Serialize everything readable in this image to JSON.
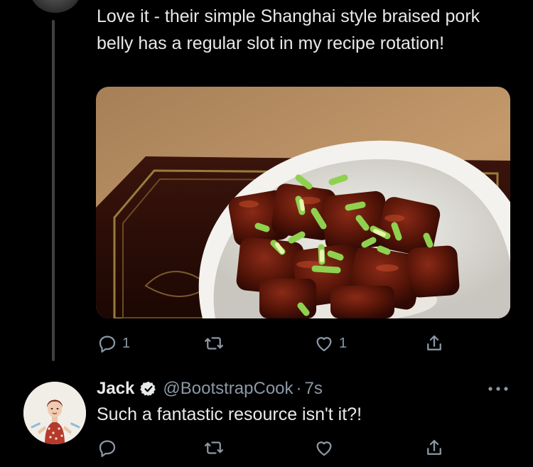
{
  "thread": {
    "parent_tweet": {
      "text": "Love it - their simple Shanghai style braised pork belly has a regular slot in my recipe rotation!",
      "actions": {
        "reply_count": "1",
        "retweet_count": "",
        "like_count": "1"
      }
    },
    "reply_tweet": {
      "author_name": "Jack",
      "author_handle": "@BootstrapCook",
      "separator": "·",
      "timestamp": "7s",
      "text": "Such a fantastic resource isn't it?!",
      "actions": {
        "reply_count": "",
        "retweet_count": "",
        "like_count": ""
      }
    }
  },
  "colors": {
    "background": "#000000",
    "text": "#e7e9ea",
    "muted": "#8b98a5",
    "thread_line": "#3e4144"
  },
  "icons": [
    "reply-icon",
    "retweet-icon",
    "like-icon",
    "share-icon",
    "verified-badge-icon",
    "more-options-icon"
  ]
}
